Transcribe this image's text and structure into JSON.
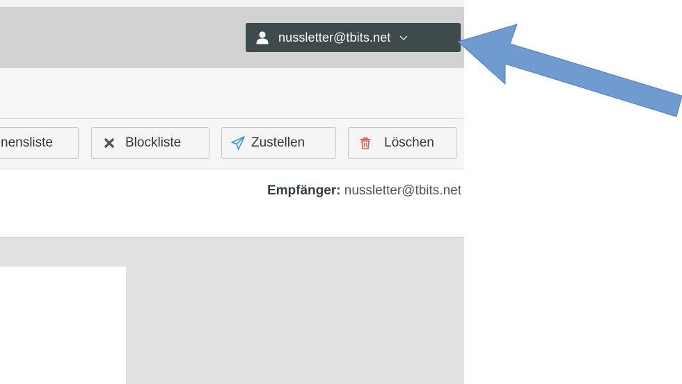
{
  "header": {
    "user_email": "nussletter@tbits.net"
  },
  "toolbar": {
    "allowlist_label": "nensliste",
    "blocklist_label": "Blockliste",
    "deliver_label": "Zustellen",
    "delete_label": "Löschen"
  },
  "message": {
    "recipient_label": "Empfänger:",
    "recipient_value": "nussletter@tbits.net"
  },
  "icons": {
    "user": "user-icon",
    "chevron": "chevron-down-icon",
    "block": "x-icon",
    "deliver": "paper-plane-icon",
    "delete": "trash-icon"
  },
  "colors": {
    "user_menu_bg": "#3e4a4b",
    "deliver_icon": "#3a9ad9",
    "delete_icon": "#e05a4a",
    "annotation_arrow": "#6f9bd1"
  }
}
